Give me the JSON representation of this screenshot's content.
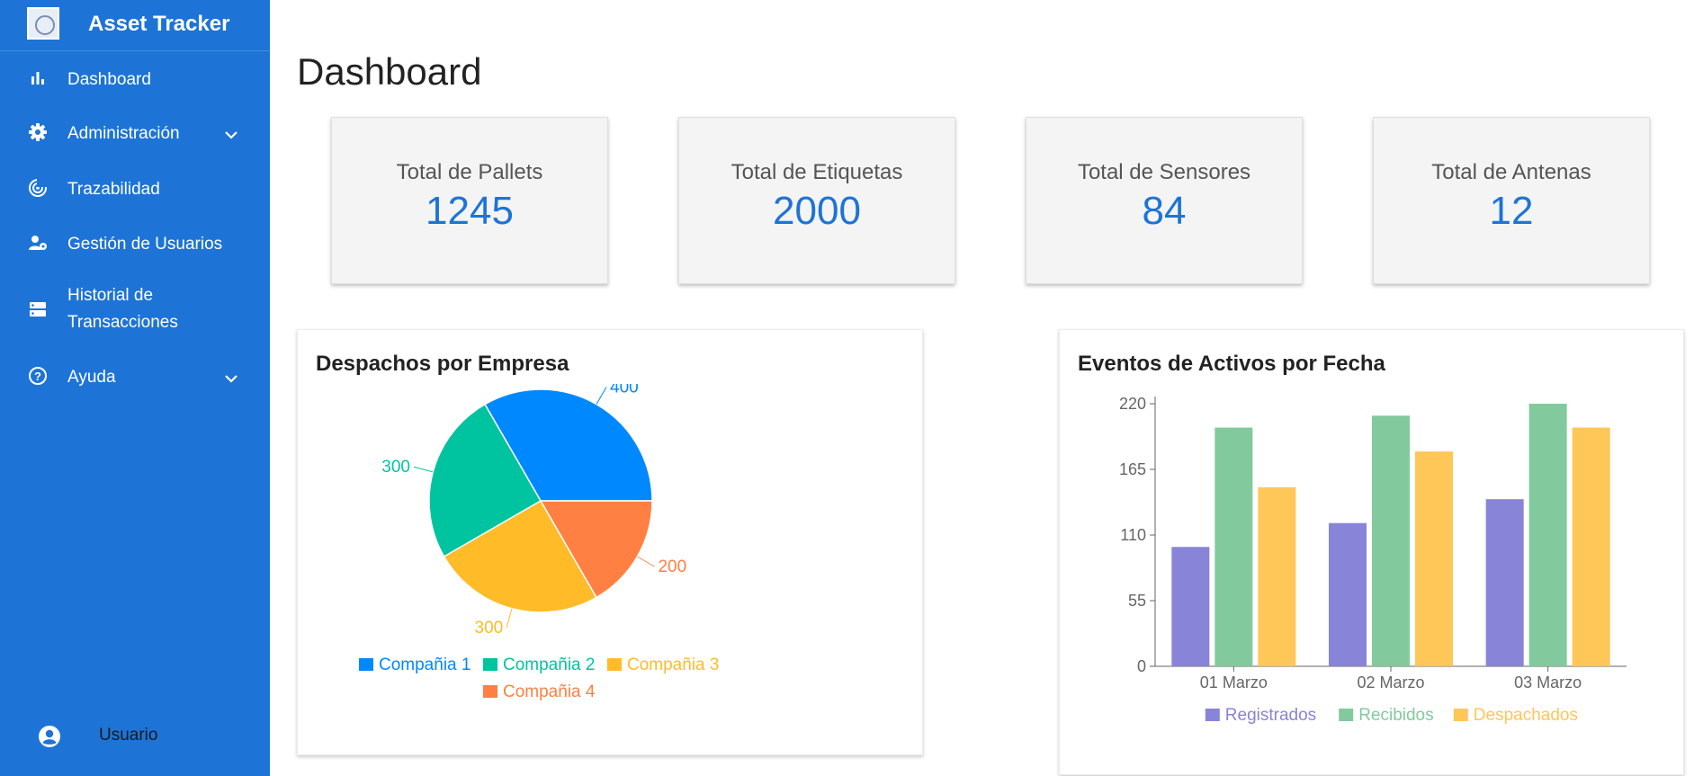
{
  "app": {
    "title": "Asset Tracker"
  },
  "sidebar": {
    "items": [
      {
        "label": "Dashboard",
        "icon": "bar-chart-icon"
      },
      {
        "label": "Administración",
        "icon": "gear-icon",
        "has_submenu": true
      },
      {
        "label": "Trazabilidad",
        "icon": "radar-icon"
      },
      {
        "label": "Gestión de Usuarios",
        "icon": "user-gear-icon"
      },
      {
        "label": "Historial de",
        "label2": "Transacciones",
        "icon": "storage-icon"
      },
      {
        "label": "Ayuda",
        "icon": "help-icon",
        "has_submenu": true
      }
    ],
    "user_label": "Usuario"
  },
  "page": {
    "title": "Dashboard"
  },
  "stats": [
    {
      "label": "Total de Pallets",
      "value": "1245"
    },
    {
      "label": "Total de Etiquetas",
      "value": "2000"
    },
    {
      "label": "Total de Sensores",
      "value": "84"
    },
    {
      "label": "Total de Antenas",
      "value": "12"
    }
  ],
  "colors": {
    "sidebar": "#1d74d6",
    "stat_value": "#1d74d6"
  },
  "chart_data": [
    {
      "type": "pie",
      "title": "Despachos por Empresa",
      "categories": [
        "Compañia 1",
        "Compañia 2",
        "Compañia 3",
        "Compañia 4"
      ],
      "values": [
        400,
        300,
        300,
        200
      ],
      "colors": [
        "#0088fe",
        "#00c49f",
        "#ffbb28",
        "#ff8042"
      ],
      "legend": "bottom"
    },
    {
      "type": "bar",
      "title": "Eventos de Activos por Fecha",
      "categories": [
        "01 Marzo",
        "02 Marzo",
        "03 Marzo"
      ],
      "series": [
        {
          "name": "Registrados",
          "values": [
            100,
            120,
            140
          ],
          "color": "#8884d8"
        },
        {
          "name": "Recibidos",
          "values": [
            200,
            210,
            220
          ],
          "color": "#82ca9d"
        },
        {
          "name": "Despachados",
          "values": [
            150,
            180,
            200
          ],
          "color": "#ffc658"
        }
      ],
      "yticks": [
        0,
        55,
        110,
        165,
        220
      ],
      "ylim": [
        0,
        220
      ],
      "legend": "bottom"
    }
  ]
}
